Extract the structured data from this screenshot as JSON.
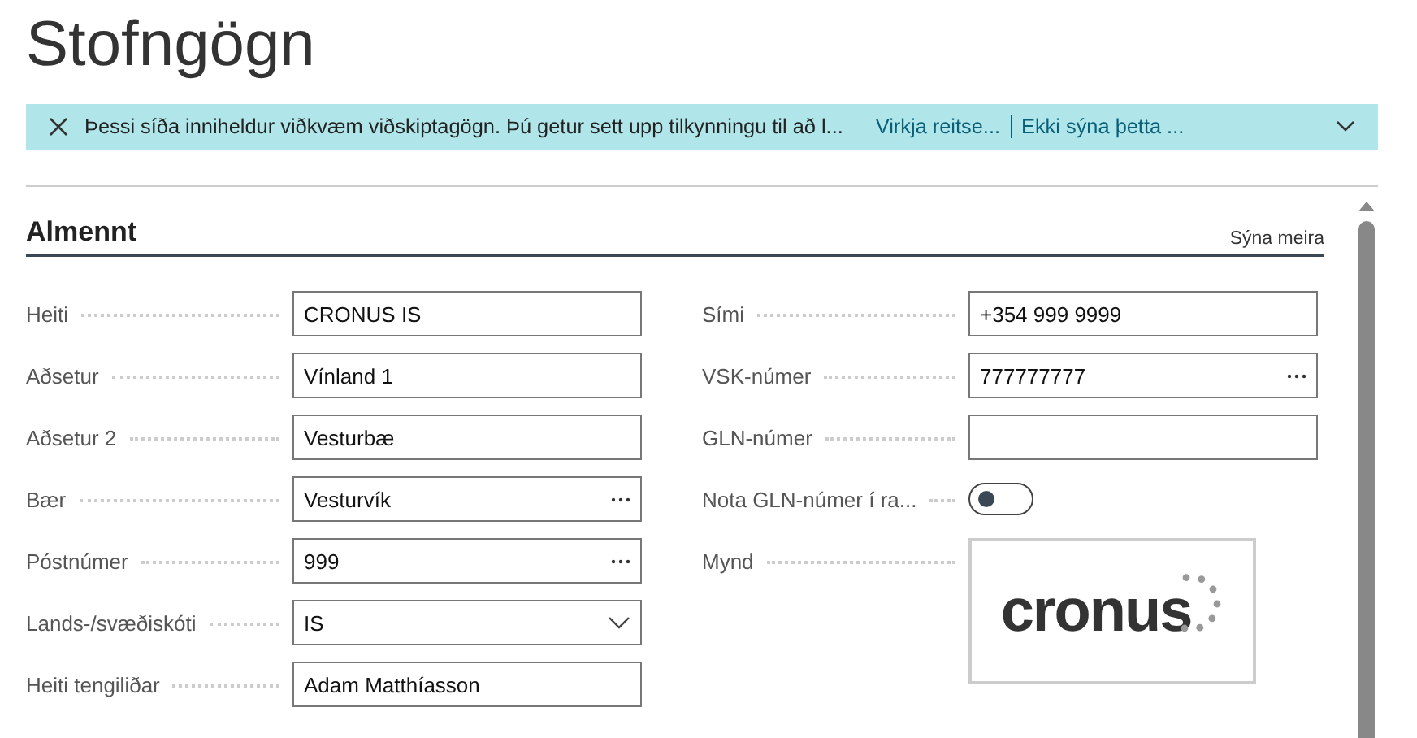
{
  "page_title": "Stofngögn",
  "banner": {
    "message": "Þessi síða inniheldur viðkvæm viðskiptagögn. Þú getur sett upp tilkynningu til að l...",
    "actions": [
      "Virkja reitse...",
      "Ekki sýna þetta ..."
    ]
  },
  "section": {
    "title": "Almennt",
    "show_more": "Sýna meira"
  },
  "columns": [
    [
      {
        "kind": "text",
        "label": "Heiti",
        "value": "CRONUS IS"
      },
      {
        "kind": "text",
        "label": "Aðsetur",
        "value": "Vínland 1"
      },
      {
        "kind": "text",
        "label": "Aðsetur 2",
        "value": "Vesturbæ"
      },
      {
        "kind": "lookup",
        "label": "Bær",
        "value": "Vesturvík"
      },
      {
        "kind": "lookup",
        "label": "Póstnúmer",
        "value": "999"
      },
      {
        "kind": "dropdown",
        "label": "Lands-/svæðiskóti",
        "value": "IS"
      },
      {
        "kind": "text",
        "label": "Heiti tengiliðar",
        "value": "Adam Matthíasson"
      }
    ],
    [
      {
        "kind": "text",
        "label": "Sími",
        "value": "+354 999 9999"
      },
      {
        "kind": "lookup",
        "label": "VSK-númer",
        "value": "777777777"
      },
      {
        "kind": "text",
        "label": "GLN-númer"
      },
      {
        "kind": "toggle",
        "label": "Nota GLN-númer í ra...",
        "on": false
      },
      {
        "kind": "image",
        "label": "Mynd",
        "logo_text": "cronus"
      }
    ]
  ]
}
